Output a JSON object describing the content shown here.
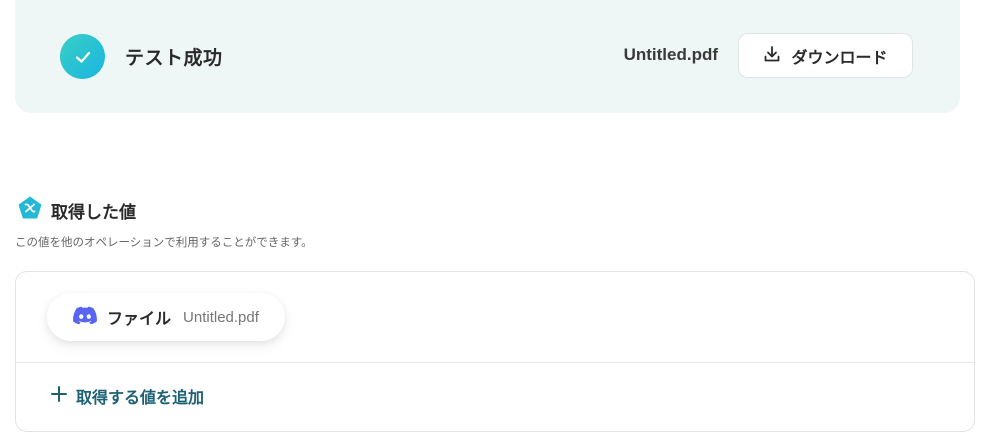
{
  "result": {
    "title": "テスト成功",
    "file_name": "Untitled.pdf",
    "download_label": "ダウンロード",
    "status_color": "#22c1d6"
  },
  "acquired": {
    "title": "取得した値",
    "description": "この値を他のオペレーションで利用することができます。",
    "items": [
      {
        "label": "ファイル",
        "value": "Untitled.pdf",
        "icon": "discord-icon"
      }
    ],
    "add_label": "取得する値を追加"
  }
}
